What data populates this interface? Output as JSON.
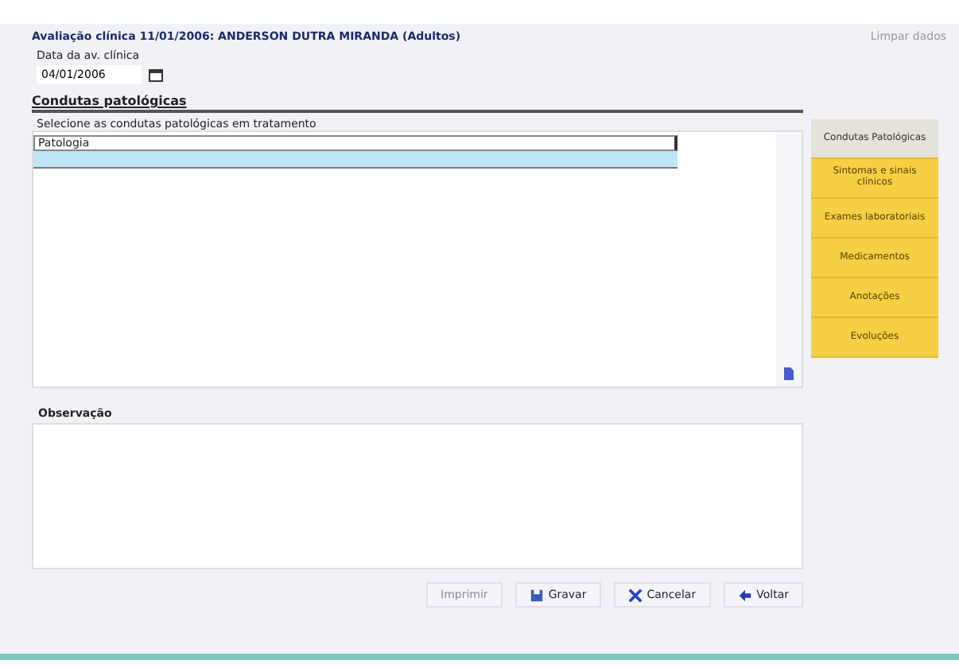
{
  "window": {
    "title": "Avaliação clínica 11/01/2006: ANDERSON DUTRA MIRANDA (Adultos)",
    "corner_text": "Limpar dados"
  },
  "date_field": {
    "label": "Data da av. clínica",
    "value": "04/01/2006"
  },
  "section": {
    "title": "Condutas patológicas",
    "hint": "Selecione as condutas patológicas em tratamento"
  },
  "table": {
    "columns": [
      "Patologia"
    ],
    "rows": [
      {
        "cells": [
          ""
        ],
        "selected": true
      }
    ]
  },
  "notes": {
    "label": "Observação"
  },
  "side_tabs": [
    {
      "label": "Condutas Patológicas",
      "selected": true
    },
    {
      "label": "Sintomas e sinais clínicos",
      "selected": false
    },
    {
      "label": "Exames laboratoriais",
      "selected": false
    },
    {
      "label": "Medicamentos",
      "selected": false
    },
    {
      "label": "Anotações",
      "selected": false
    },
    {
      "label": "Evoluções",
      "selected": false
    }
  ],
  "buttons": [
    {
      "label": "Imprimir",
      "kind": "plain",
      "disabled": true
    },
    {
      "label": "Gravar",
      "kind": "save",
      "disabled": false
    },
    {
      "label": "Cancelar",
      "kind": "cancel",
      "disabled": false
    },
    {
      "label": "Voltar",
      "kind": "back",
      "disabled": false
    }
  ]
}
